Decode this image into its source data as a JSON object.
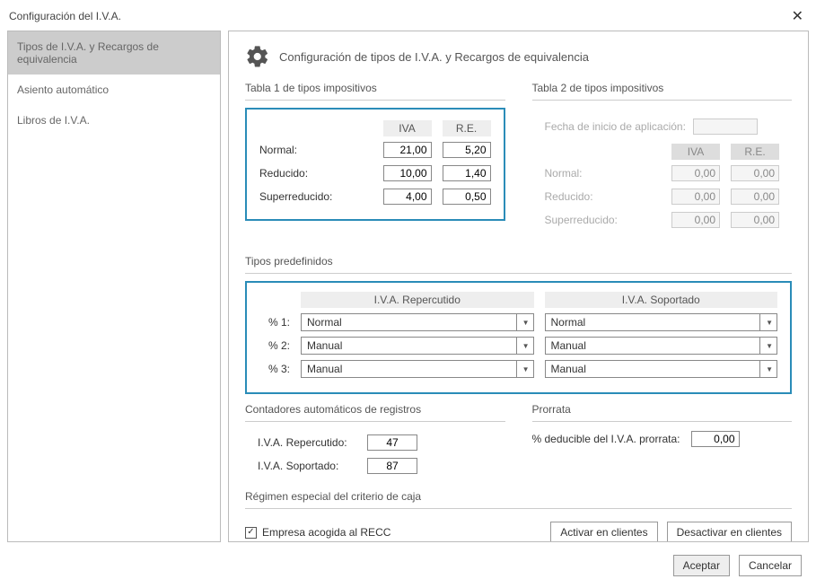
{
  "titlebar": {
    "title": "Configuración del I.V.A."
  },
  "sidebar": {
    "items": [
      {
        "label": "Tipos de I.V.A. y Recargos de equivalencia"
      },
      {
        "label": "Asiento automático"
      },
      {
        "label": "Libros de I.V.A."
      }
    ]
  },
  "page": {
    "title": "Configuración de tipos de I.V.A. y Recargos de equivalencia"
  },
  "tabla1": {
    "title": "Tabla 1 de tipos impositivos",
    "col_iva": "IVA",
    "col_re": "R.E.",
    "rows": {
      "normal": {
        "label": "Normal:",
        "iva": "21,00",
        "re": "5,20"
      },
      "reducido": {
        "label": "Reducido:",
        "iva": "10,00",
        "re": "1,40"
      },
      "superreducido": {
        "label": "Superreducido:",
        "iva": "4,00",
        "re": "0,50"
      }
    }
  },
  "tabla2": {
    "title": "Tabla 2 de tipos impositivos",
    "fecha_label": "Fecha de inicio de aplicación:",
    "fecha": "",
    "col_iva": "IVA",
    "col_re": "R.E.",
    "rows": {
      "normal": {
        "label": "Normal:",
        "iva": "0,00",
        "re": "0,00"
      },
      "reducido": {
        "label": "Reducido:",
        "iva": "0,00",
        "re": "0,00"
      },
      "superreducido": {
        "label": "Superreducido:",
        "iva": "0,00",
        "re": "0,00"
      }
    }
  },
  "predef": {
    "title": "Tipos predefinidos",
    "header_rep": "I.V.A. Repercutido",
    "header_sop": "I.V.A. Soportado",
    "rows": [
      {
        "label": "% 1:",
        "rep": "Normal",
        "sop": "Normal"
      },
      {
        "label": "% 2:",
        "rep": "Manual",
        "sop": "Manual"
      },
      {
        "label": "% 3:",
        "rep": "Manual",
        "sop": "Manual"
      }
    ]
  },
  "contadores": {
    "title": "Contadores automáticos de registros",
    "rep_label": "I.V.A. Repercutido:",
    "rep_value": "47",
    "sop_label": "I.V.A. Soportado:",
    "sop_value": "87"
  },
  "prorrata": {
    "title": "Prorrata",
    "label": "% deducible del I.V.A. prorrata:",
    "value": "0,00"
  },
  "regimen": {
    "title": "Régimen especial del criterio de caja",
    "checkbox_label": "Empresa acogida al RECC",
    "btn_activar": "Activar en clientes",
    "btn_desactivar": "Desactivar en clientes"
  },
  "footer": {
    "aceptar": "Aceptar",
    "cancelar": "Cancelar"
  }
}
